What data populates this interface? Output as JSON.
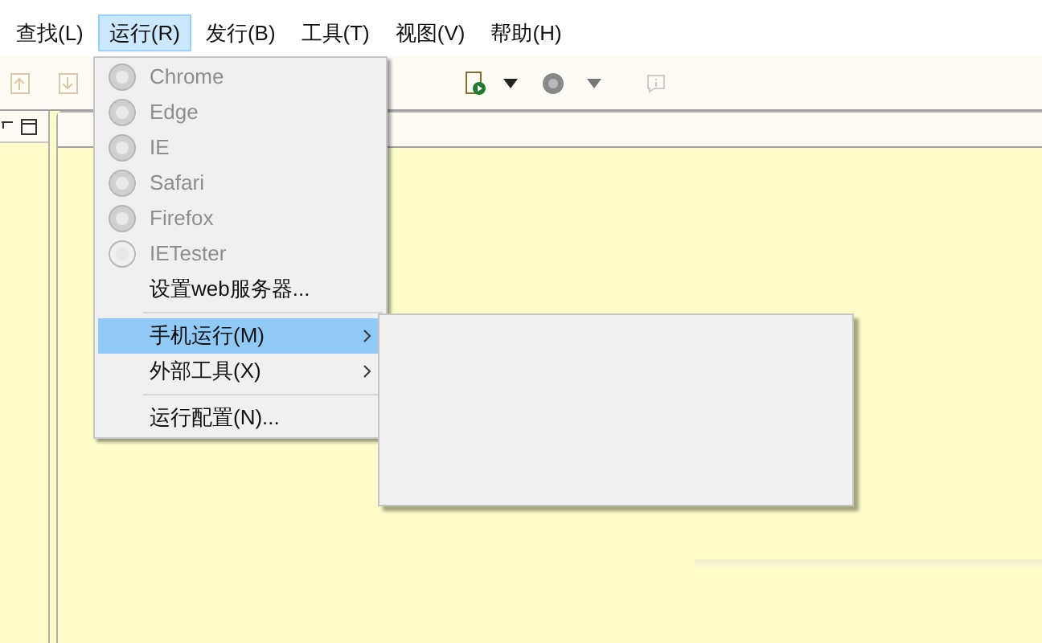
{
  "menubar": [
    {
      "label": "查找(L)",
      "selected": false
    },
    {
      "label": "运行(R)",
      "selected": true
    },
    {
      "label": "发行(B)",
      "selected": false
    },
    {
      "label": "工具(T)",
      "selected": false
    },
    {
      "label": "视图(V)",
      "selected": false
    },
    {
      "label": "帮助(H)",
      "selected": false
    }
  ],
  "run_menu": [
    {
      "kind": "browser",
      "label": "Chrome",
      "disabled": true,
      "selected": false
    },
    {
      "kind": "browser",
      "label": "Edge",
      "disabled": true,
      "selected": false
    },
    {
      "kind": "browser",
      "label": "IE",
      "disabled": true,
      "selected": false
    },
    {
      "kind": "browser",
      "label": "Safari",
      "disabled": true,
      "selected": false
    },
    {
      "kind": "browser",
      "label": "Firefox",
      "disabled": true,
      "selected": false
    },
    {
      "kind": "browser",
      "label": "IETester",
      "disabled": true,
      "selected": false
    },
    {
      "kind": "item",
      "label": "设置web服务器...",
      "disabled": false,
      "selected": false
    },
    {
      "kind": "separator"
    },
    {
      "kind": "submenu",
      "label": "手机运行(M)",
      "disabled": false,
      "selected": true
    },
    {
      "kind": "submenu",
      "label": "外部工具(X)",
      "disabled": false,
      "selected": false
    },
    {
      "kind": "separator"
    },
    {
      "kind": "item",
      "label": "运行配置(N)...",
      "disabled": false,
      "selected": false
    }
  ],
  "submenu_open": true
}
